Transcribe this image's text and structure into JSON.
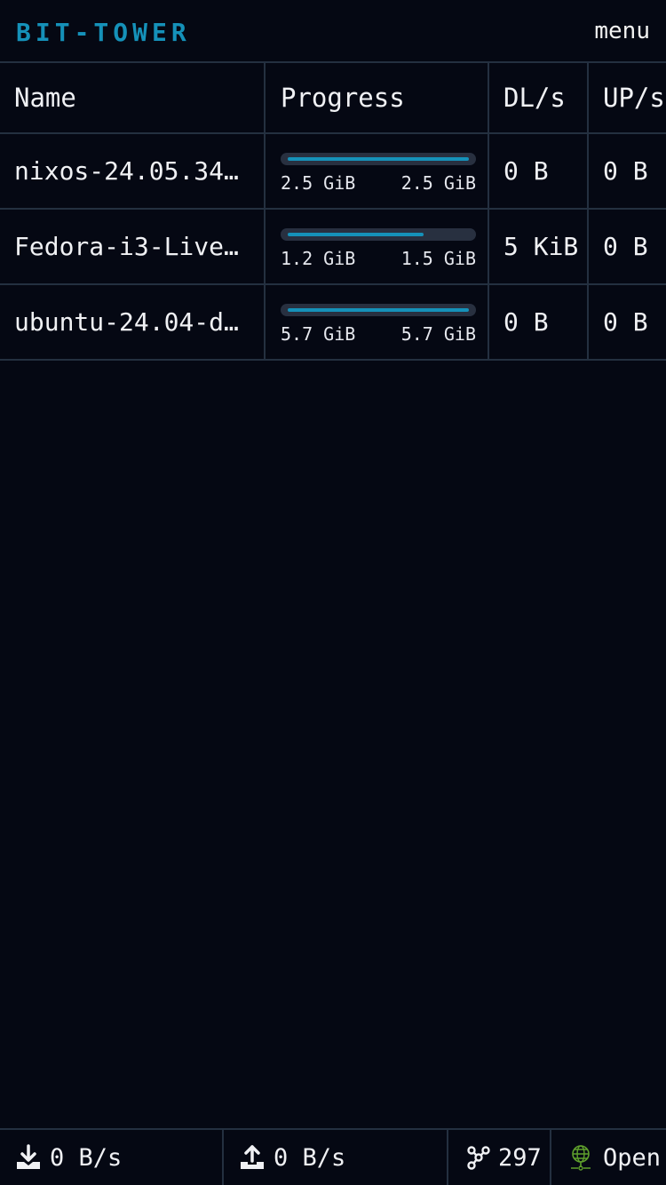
{
  "app": {
    "title": "BIT-TOWER",
    "menu_label": "menu"
  },
  "colors": {
    "background": "#050813",
    "accent": "#1591b9",
    "divider": "#243040",
    "open_status": "#5fa02c"
  },
  "table": {
    "headers": {
      "name": "Name",
      "progress": "Progress",
      "dl": "DL/s",
      "up": "UP/s"
    },
    "rows": [
      {
        "name": "nixos-24.05.34...",
        "downloaded": "2.5 GiB",
        "total": "2.5 GiB",
        "progress": 1.0,
        "dl": "0 B",
        "up": "0 B"
      },
      {
        "name": "Fedora-i3-Live...",
        "downloaded": "1.2 GiB",
        "total": "1.5 GiB",
        "progress": 0.75,
        "dl": "5 KiB",
        "up": "0 B"
      },
      {
        "name": "ubuntu-24.04-d...",
        "downloaded": "5.7 GiB",
        "total": "5.7 GiB",
        "progress": 1.0,
        "dl": "0 B",
        "up": "0 B"
      }
    ]
  },
  "footer": {
    "download_rate": "0 B/s",
    "upload_rate": "0 B/s",
    "peers": "297",
    "network_status": "Open",
    "icons": {
      "download": "download-icon",
      "upload": "upload-icon",
      "peers": "peers-icon",
      "network": "globe-icon"
    }
  }
}
